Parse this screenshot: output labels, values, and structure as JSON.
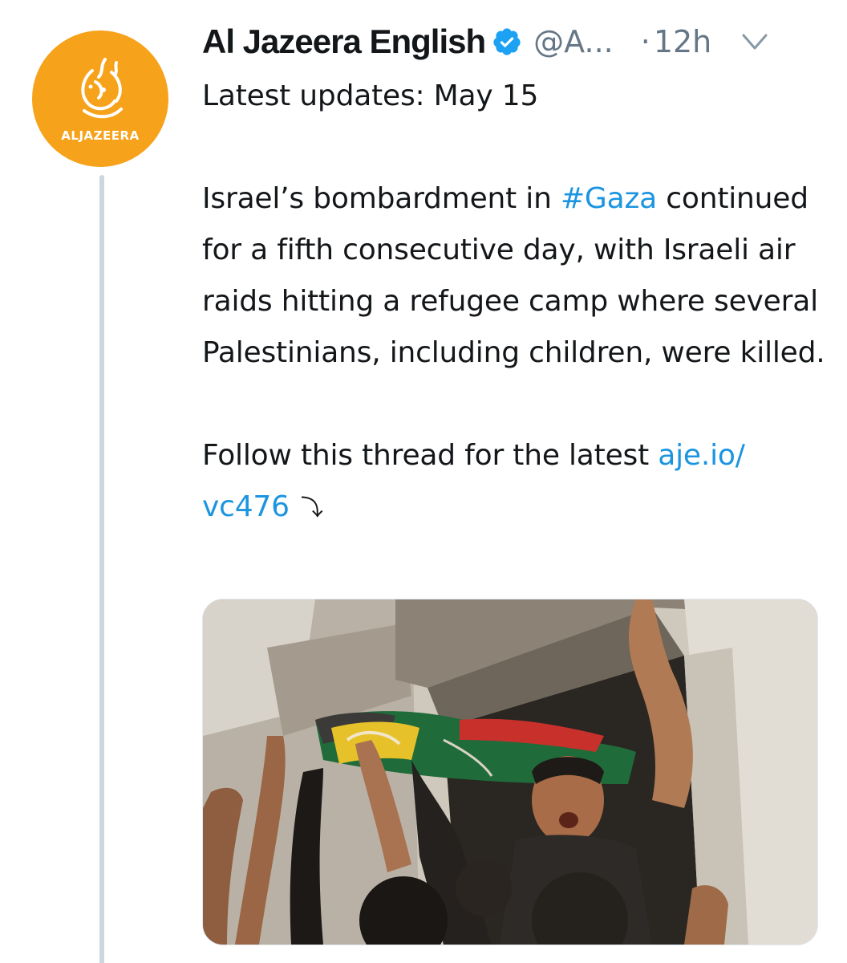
{
  "account": {
    "display_name": "Al Jazeera English",
    "handle": "@A...",
    "separator": "·",
    "time": "12h",
    "avatar_text": "ALJAZEERA",
    "verified_icon": "verified-badge-icon",
    "menu_icon": "chevron-down-icon"
  },
  "tweet": {
    "title": "Latest updates: May 15",
    "body_pre": "Israel’s bombardment in ",
    "hashtag": "#Gaza",
    "body_post": " continued for a fifth consecutive day, with Israeli air raids hitting a refugee camp where several Palestinians, including children, were killed.",
    "follow_text": "Follow this thread for the latest ",
    "link_part1": "aje.io/",
    "link_part2": "vc476",
    "thread_glyph": "⤵"
  },
  "colors": {
    "brand_orange": "#f7a21b",
    "link_blue": "#1b95e0",
    "verified_blue": "#1da1f2",
    "muted_text": "#657786",
    "thread_line": "#ccd6dd"
  }
}
